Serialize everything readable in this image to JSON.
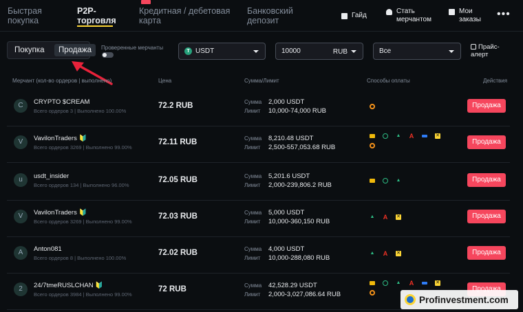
{
  "nav": {
    "tabs": [
      {
        "line1": "Быстрая",
        "line2": "покупка"
      },
      {
        "line1": "P2P-",
        "line2": "торговля"
      },
      {
        "line1": "Кредитная / дебетовая",
        "line2": "карта"
      },
      {
        "line1": "Банковский",
        "line2": "депозит"
      }
    ],
    "guide": "Гайд",
    "merchant_line1": "Стать",
    "merchant_line2": "мерчантом",
    "orders_line1": "Мои",
    "orders_line2": "заказы",
    "more": "•••"
  },
  "filters": {
    "buy": "Покупка",
    "sell": "Продажа",
    "verified_label": "Проверенные мерчанты",
    "asset": "USDT",
    "asset_icon": "T",
    "amount": "10000",
    "currency": "RUB",
    "payment": "Все",
    "price_alert_line1": "Прайс-",
    "price_alert_line2": "алерт"
  },
  "table": {
    "headers": {
      "merchant": "Мерчант (кол-во ордеров | выполнено)",
      "price": "Цена",
      "amount": "Сумма/Лимит",
      "payment": "Способы оплаты",
      "actions": "Действия"
    },
    "label_sum": "Сумма",
    "label_limit": "Лимит",
    "sell_label": "Продажа",
    "rows": [
      {
        "avatar": "C",
        "name": "CRYPTO $CREAM",
        "stats": "Всего ордеров 3 | Выполнено 100.00%",
        "price": "72.2 RUB",
        "sum": "2,000 USDT",
        "limit": "10,000-74,000 RUB"
      },
      {
        "avatar": "V",
        "name": "VavilonTraders 🔰",
        "stats": "Всего ордеров 3269 | Выполнено 99.00%",
        "price": "72.11 RUB",
        "sum": "8,210.48 USDT",
        "limit": "2,500-557,053.68 RUB"
      },
      {
        "avatar": "u",
        "name": "usdt_insider",
        "stats": "Всего ордеров 134 | Выполнено 96.00%",
        "price": "72.05 RUB",
        "sum": "5,201.6 USDT",
        "limit": "2,000-239,806.2 RUB"
      },
      {
        "avatar": "V",
        "name": "VavilonTraders 🔰",
        "stats": "Всего ордеров 3269 | Выполнено 99.00%",
        "price": "72.03 RUB",
        "sum": "5,000 USDT",
        "limit": "10,000-360,150 RUB"
      },
      {
        "avatar": "A",
        "name": "Anton081",
        "stats": "Всего ордеров 8 | Выполнено 100.00%",
        "price": "72.02 RUB",
        "sum": "4,000 USDT",
        "limit": "10,000-288,080 RUB"
      },
      {
        "avatar": "2",
        "name": "24/7tmeRUSLCHAN 🔰",
        "stats": "Всего ордеров 3984 | Выполнено 99.00%",
        "price": "72 RUB",
        "sum": "42,528.29 USDT",
        "limit": "2,000-3,027,086.64 RUB"
      }
    ]
  },
  "watermark": "Profinvestment.com",
  "colors": {
    "accent": "#fcd535",
    "sell": "#f6465d",
    "bg": "#0b0e11"
  }
}
